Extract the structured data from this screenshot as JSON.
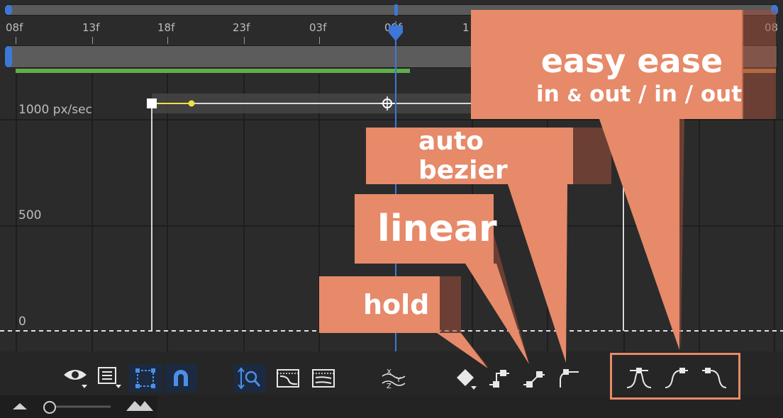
{
  "timeline": {
    "ticks": [
      "08f",
      "13f",
      "18f",
      "23f",
      "03f",
      "08f",
      "1",
      "08"
    ]
  },
  "graph": {
    "value_labels": [
      "1000 px/sec",
      "500",
      "0"
    ]
  },
  "callouts": {
    "hold": "hold",
    "linear": "linear",
    "auto_bezier": "auto bezier",
    "easy_ease_title": "easy ease",
    "easy_ease_in": "in",
    "easy_ease_amp": "&",
    "easy_ease_out": "out / in / out"
  },
  "icons": {
    "toolbar": [
      "eye-icon",
      "list-icon",
      "transform-box-icon",
      "snap-magnet-icon",
      "fit-zoom-icon",
      "graph-view-icon",
      "graph-view-2-icon",
      "separate-dimensions-icon",
      "keyframe-diamond-icon",
      "hold-keyframe-icon",
      "linear-keyframe-icon",
      "auto-bezier-keyframe-icon",
      "easy-ease-icon",
      "easy-ease-in-icon",
      "easy-ease-out-icon"
    ]
  },
  "colors": {
    "accent": "#3d78d8",
    "callout": "#e68a6a",
    "highlight_box": "#e68a6a",
    "green": "#5fae4a",
    "yellow": "#f0e040"
  }
}
